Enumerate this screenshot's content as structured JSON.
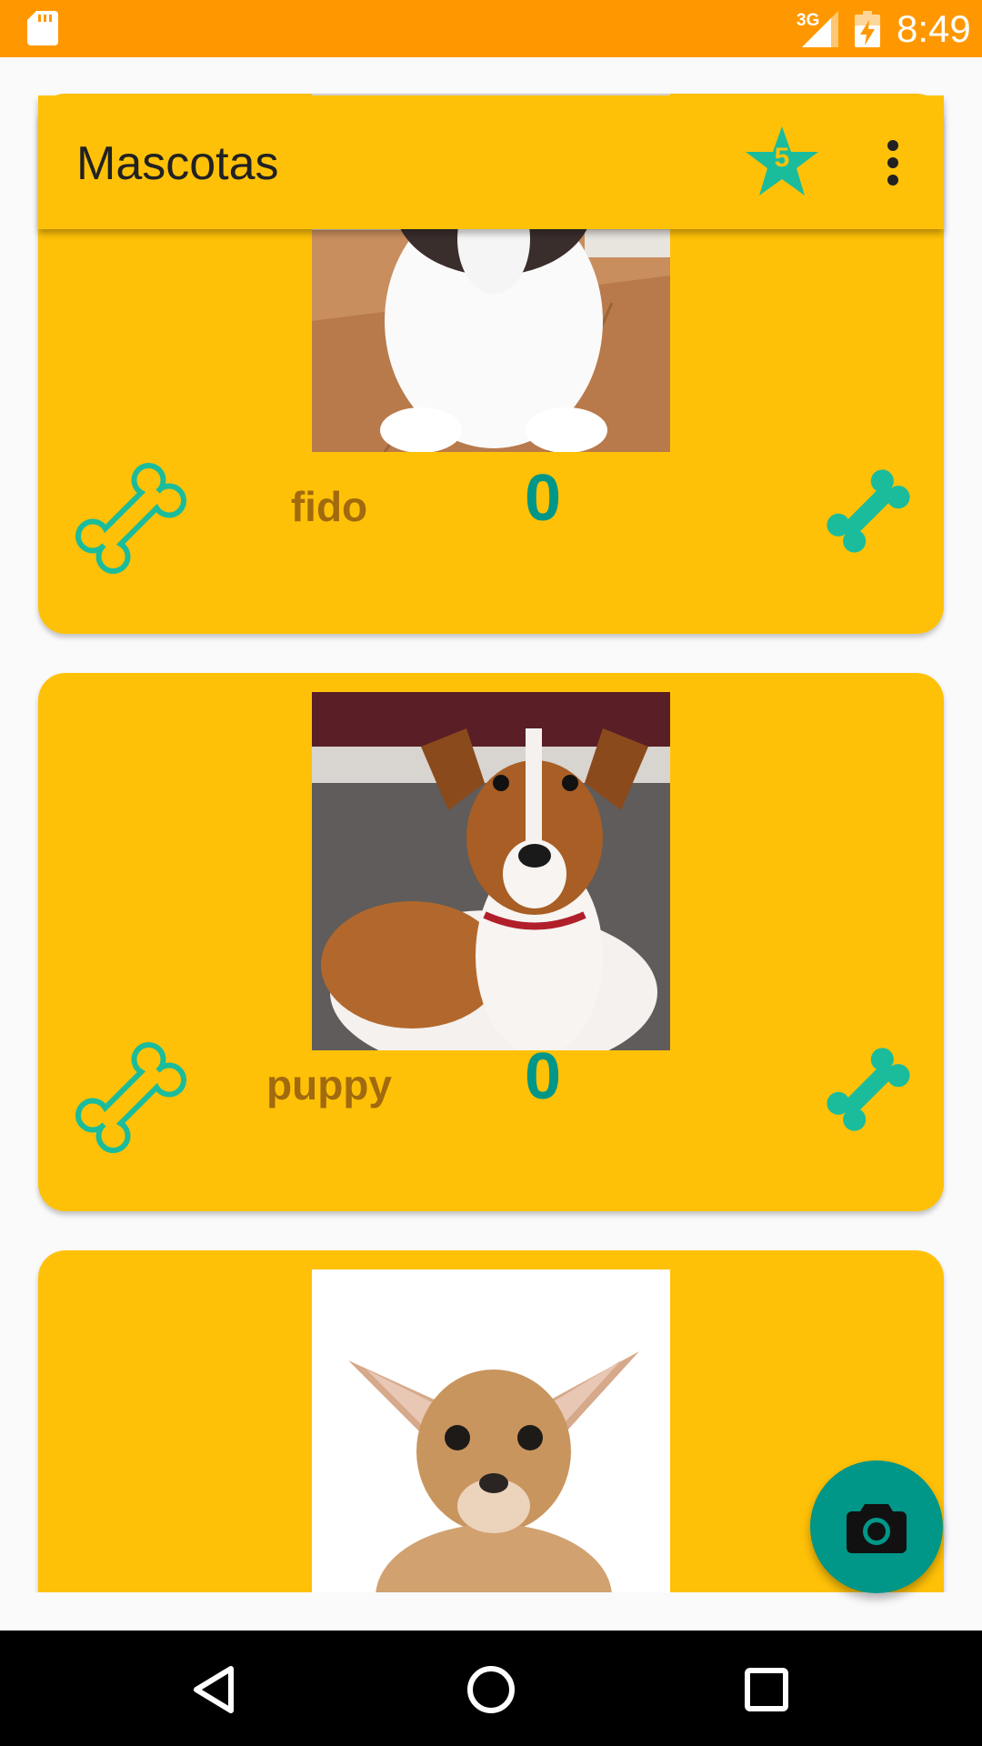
{
  "status_bar": {
    "network": "3G",
    "time": "8:49",
    "icons": [
      "sd-card-icon",
      "signal-icon",
      "battery-charging-icon"
    ]
  },
  "app_bar": {
    "title": "Mascotas",
    "favorites_count": "5",
    "icons": [
      "star-icon",
      "more-vert-icon"
    ]
  },
  "pets": [
    {
      "name": "fido",
      "likes": "0",
      "photo": "beagle puppy",
      "icons": [
        "bone-outline-icon",
        "bone-filled-icon"
      ]
    },
    {
      "name": "puppy",
      "likes": "0",
      "photo": "jack russell terrier",
      "icons": [
        "bone-outline-icon",
        "bone-filled-icon"
      ]
    },
    {
      "name": "",
      "likes": "",
      "photo": "chihuahua",
      "icons": []
    }
  ],
  "fab": {
    "icon": "camera-icon"
  },
  "nav_bar": {
    "icons": [
      "back-icon",
      "home-icon",
      "recents-icon"
    ]
  },
  "colors": {
    "status_bar": "#FF9800",
    "primary": "#FFC107",
    "accent": "#009688",
    "bone": "#1ABC9C",
    "name_text": "#A16A0E"
  }
}
